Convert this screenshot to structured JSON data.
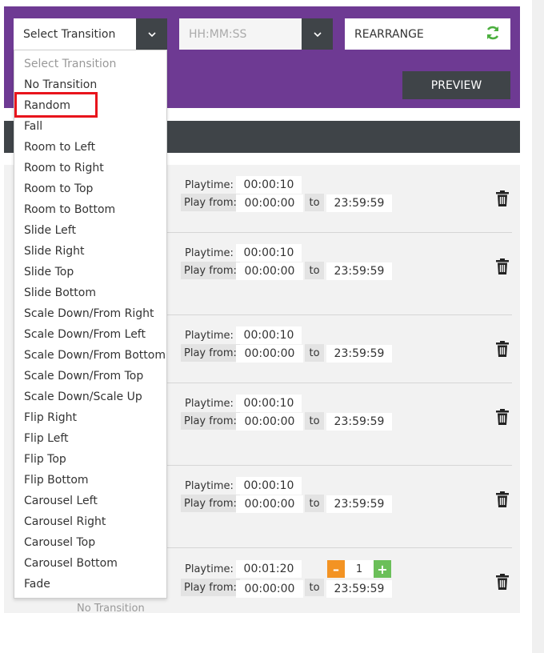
{
  "toolbar": {
    "transition_select": "Select Transition",
    "time_placeholder": "HH:MM:SS",
    "rearrange_label": "REARRANGE",
    "preview_label": "PREVIEW"
  },
  "dropdown": {
    "options": [
      "Select Transition",
      "No Transition",
      "Random",
      "Fall",
      "Room to Left",
      "Room to Right",
      "Room to Top",
      "Room to Bottom",
      "Slide Left",
      "Slide Right",
      "Slide Top",
      "Slide Bottom",
      "Scale Down/From Right",
      "Scale Down/From Left",
      "Scale Down/From Bottom",
      "Scale Down/From Top",
      "Scale Down/Scale Up",
      "Flip Right",
      "Flip Left",
      "Flip Top",
      "Flip Bottom",
      "Carousel Left",
      "Carousel Right",
      "Carousel Top",
      "Carousel Bottom",
      "Fade"
    ],
    "highlighted": "Random"
  },
  "labels": {
    "playtime": "Playtime:",
    "play_from": "Play from:",
    "to": "to"
  },
  "rows": [
    {
      "playtime": "00:00:10",
      "from": "00:00:00",
      "to": "23:59:59"
    },
    {
      "playtime": "00:00:10",
      "from": "00:00:00",
      "to": "23:59:59"
    },
    {
      "playtime": "00:00:10",
      "from": "00:00:00",
      "to": "23:59:59"
    },
    {
      "playtime": "00:00:10",
      "from": "00:00:00",
      "to": "23:59:59"
    },
    {
      "playtime": "00:00:10",
      "from": "00:00:00",
      "to": "23:59:59"
    },
    {
      "playtime": "00:01:20",
      "from": "00:00:00",
      "to": "23:59:59",
      "stepper": "1"
    }
  ],
  "stepper": {
    "minus": "–",
    "plus": "+"
  },
  "bottom_label": "No Transition",
  "colors": {
    "purple": "#6e3a93",
    "dark": "#3f4448",
    "orange": "#f39323",
    "green": "#6bbf59",
    "highlight": "#e8141c"
  }
}
